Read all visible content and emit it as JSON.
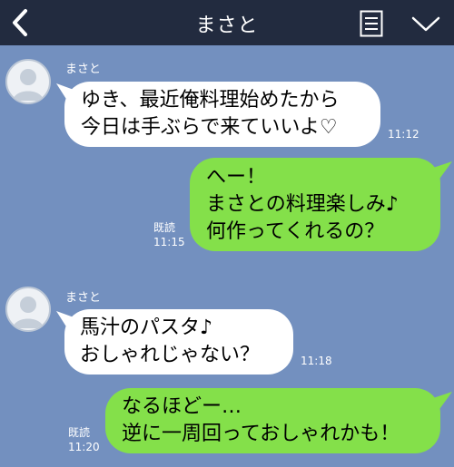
{
  "header": {
    "title": "まさと",
    "back_icon": "chevron-left-icon",
    "menu_icon": "list-icon",
    "dropdown_icon": "chevron-down-icon",
    "bg_color": "#222b3f"
  },
  "chat": {
    "bg_color": "#7390bf",
    "incoming_color": "#ffffff",
    "outgoing_color": "#84e04a",
    "messages": [
      {
        "direction": "in",
        "sender": "まさと",
        "text": "ゆき、最近俺料理始めたから\n今日は手ぶらで来ていいよ♡",
        "time": "11:12"
      },
      {
        "direction": "out",
        "read": "既読",
        "text": "へー！\nまさとの料理楽しみ♪\n何作ってくれるの？",
        "time": "11:15"
      },
      {
        "direction": "in",
        "sender": "まさと",
        "text": "馬汁のパスタ♪\nおしゃれじゃない？",
        "time": "11:18"
      },
      {
        "direction": "out",
        "read": "既読",
        "text": "なるほどー…\n逆に一周回っておしゃれかも！",
        "time": "11:20"
      }
    ]
  }
}
